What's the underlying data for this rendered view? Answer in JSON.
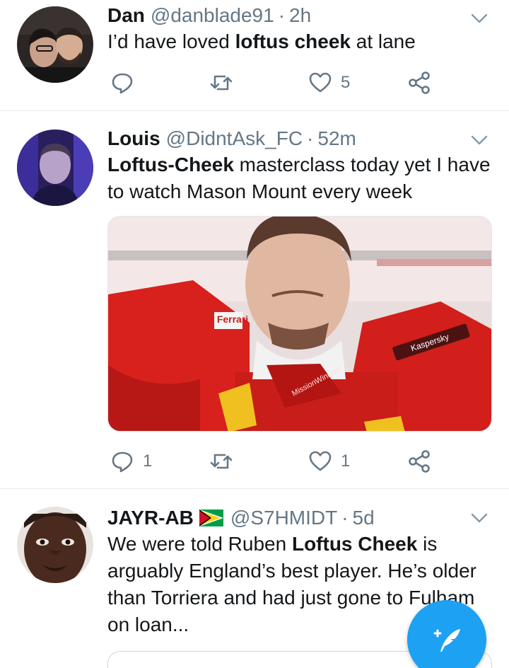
{
  "tweets": [
    {
      "name": "Dan",
      "handle": "@danblade91",
      "separator": "·",
      "time": "2h",
      "text_parts": [
        "I’d have loved ",
        "loftus cheek",
        " at lane"
      ],
      "reply_count": "",
      "retweet_count": "",
      "like_count": "5"
    },
    {
      "name": "Louis",
      "handle": "@DidntAsk_FC",
      "separator": "·",
      "time": "52m",
      "text_parts": [
        "Loftus-Cheek",
        " masterclass today yet I have to watch Mason Mount every week"
      ],
      "media_texts": [
        "Kaspersky",
        "MissionWinnow",
        "Ferrari"
      ],
      "reply_count": "1",
      "retweet_count": "",
      "like_count": "1"
    },
    {
      "name": "JAYR-AB",
      "flag": "guyana-flag",
      "handle": "@S7HMIDT",
      "separator": "·",
      "time": "5d",
      "text_parts": [
        "We were told Ruben ",
        "Loftus Cheek",
        " is arguably England’s best player. He’s older than Torriera and had just gone to Fulham on loan..."
      ]
    }
  ],
  "colors": {
    "accent": "#1da1f2",
    "muted": "#657786",
    "text": "#14171a",
    "divider": "#e6ecf0"
  }
}
